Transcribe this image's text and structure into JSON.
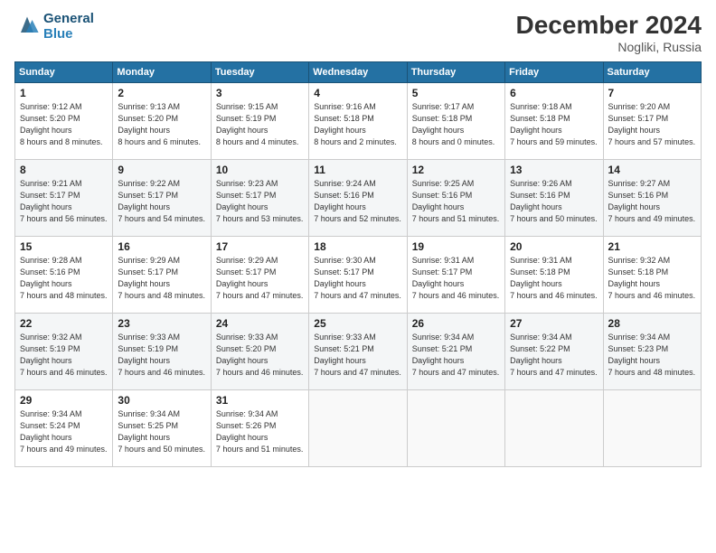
{
  "logo": {
    "line1": "General",
    "line2": "Blue"
  },
  "title": "December 2024",
  "location": "Nogliki, Russia",
  "weekdays": [
    "Sunday",
    "Monday",
    "Tuesday",
    "Wednesday",
    "Thursday",
    "Friday",
    "Saturday"
  ],
  "weeks": [
    [
      {
        "day": "1",
        "sunrise": "9:12 AM",
        "sunset": "5:20 PM",
        "daylight": "8 hours and 8 minutes."
      },
      {
        "day": "2",
        "sunrise": "9:13 AM",
        "sunset": "5:20 PM",
        "daylight": "8 hours and 6 minutes."
      },
      {
        "day": "3",
        "sunrise": "9:15 AM",
        "sunset": "5:19 PM",
        "daylight": "8 hours and 4 minutes."
      },
      {
        "day": "4",
        "sunrise": "9:16 AM",
        "sunset": "5:18 PM",
        "daylight": "8 hours and 2 minutes."
      },
      {
        "day": "5",
        "sunrise": "9:17 AM",
        "sunset": "5:18 PM",
        "daylight": "8 hours and 0 minutes."
      },
      {
        "day": "6",
        "sunrise": "9:18 AM",
        "sunset": "5:18 PM",
        "daylight": "7 hours and 59 minutes."
      },
      {
        "day": "7",
        "sunrise": "9:20 AM",
        "sunset": "5:17 PM",
        "daylight": "7 hours and 57 minutes."
      }
    ],
    [
      {
        "day": "8",
        "sunrise": "9:21 AM",
        "sunset": "5:17 PM",
        "daylight": "7 hours and 56 minutes."
      },
      {
        "day": "9",
        "sunrise": "9:22 AM",
        "sunset": "5:17 PM",
        "daylight": "7 hours and 54 minutes."
      },
      {
        "day": "10",
        "sunrise": "9:23 AM",
        "sunset": "5:17 PM",
        "daylight": "7 hours and 53 minutes."
      },
      {
        "day": "11",
        "sunrise": "9:24 AM",
        "sunset": "5:16 PM",
        "daylight": "7 hours and 52 minutes."
      },
      {
        "day": "12",
        "sunrise": "9:25 AM",
        "sunset": "5:16 PM",
        "daylight": "7 hours and 51 minutes."
      },
      {
        "day": "13",
        "sunrise": "9:26 AM",
        "sunset": "5:16 PM",
        "daylight": "7 hours and 50 minutes."
      },
      {
        "day": "14",
        "sunrise": "9:27 AM",
        "sunset": "5:16 PM",
        "daylight": "7 hours and 49 minutes."
      }
    ],
    [
      {
        "day": "15",
        "sunrise": "9:28 AM",
        "sunset": "5:16 PM",
        "daylight": "7 hours and 48 minutes."
      },
      {
        "day": "16",
        "sunrise": "9:29 AM",
        "sunset": "5:17 PM",
        "daylight": "7 hours and 48 minutes."
      },
      {
        "day": "17",
        "sunrise": "9:29 AM",
        "sunset": "5:17 PM",
        "daylight": "7 hours and 47 minutes."
      },
      {
        "day": "18",
        "sunrise": "9:30 AM",
        "sunset": "5:17 PM",
        "daylight": "7 hours and 47 minutes."
      },
      {
        "day": "19",
        "sunrise": "9:31 AM",
        "sunset": "5:17 PM",
        "daylight": "7 hours and 46 minutes."
      },
      {
        "day": "20",
        "sunrise": "9:31 AM",
        "sunset": "5:18 PM",
        "daylight": "7 hours and 46 minutes."
      },
      {
        "day": "21",
        "sunrise": "9:32 AM",
        "sunset": "5:18 PM",
        "daylight": "7 hours and 46 minutes."
      }
    ],
    [
      {
        "day": "22",
        "sunrise": "9:32 AM",
        "sunset": "5:19 PM",
        "daylight": "7 hours and 46 minutes."
      },
      {
        "day": "23",
        "sunrise": "9:33 AM",
        "sunset": "5:19 PM",
        "daylight": "7 hours and 46 minutes."
      },
      {
        "day": "24",
        "sunrise": "9:33 AM",
        "sunset": "5:20 PM",
        "daylight": "7 hours and 46 minutes."
      },
      {
        "day": "25",
        "sunrise": "9:33 AM",
        "sunset": "5:21 PM",
        "daylight": "7 hours and 47 minutes."
      },
      {
        "day": "26",
        "sunrise": "9:34 AM",
        "sunset": "5:21 PM",
        "daylight": "7 hours and 47 minutes."
      },
      {
        "day": "27",
        "sunrise": "9:34 AM",
        "sunset": "5:22 PM",
        "daylight": "7 hours and 47 minutes."
      },
      {
        "day": "28",
        "sunrise": "9:34 AM",
        "sunset": "5:23 PM",
        "daylight": "7 hours and 48 minutes."
      }
    ],
    [
      {
        "day": "29",
        "sunrise": "9:34 AM",
        "sunset": "5:24 PM",
        "daylight": "7 hours and 49 minutes."
      },
      {
        "day": "30",
        "sunrise": "9:34 AM",
        "sunset": "5:25 PM",
        "daylight": "7 hours and 50 minutes."
      },
      {
        "day": "31",
        "sunrise": "9:34 AM",
        "sunset": "5:26 PM",
        "daylight": "7 hours and 51 minutes."
      },
      null,
      null,
      null,
      null
    ]
  ]
}
